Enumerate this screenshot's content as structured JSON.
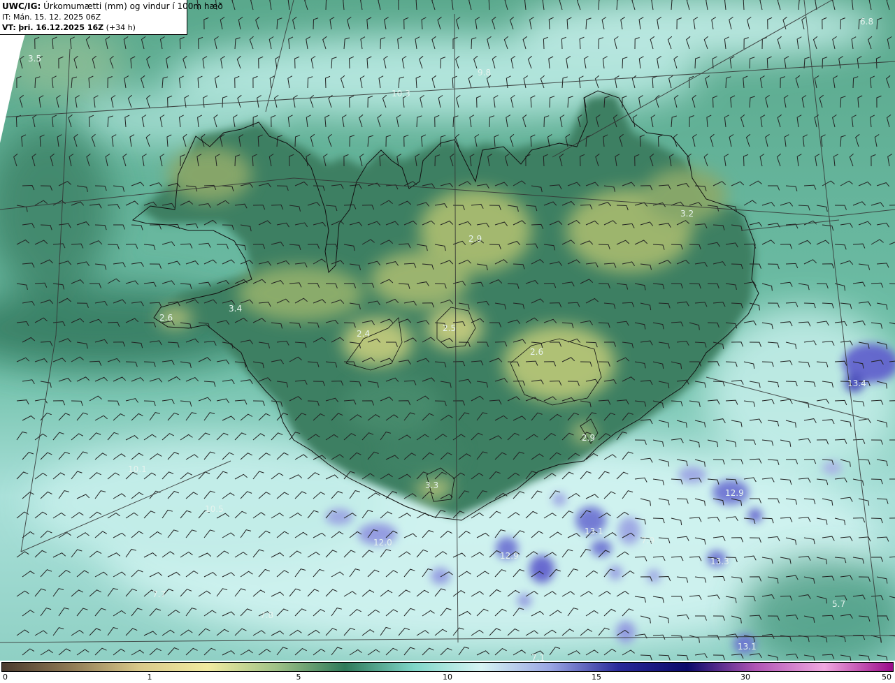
{
  "header": {
    "title_bold": "UWC/IG:",
    "title_rest": "Úrkomumætti (mm) og vindur í 100m hæð",
    "init_time": "IT: Mán. 15. 12. 2025 06Z",
    "valid_bold": "VT:",
    "valid_time": "þri. 16.12.2025 16Z",
    "valid_offset": "(+34 h)"
  },
  "colorbar": {
    "ticks": [
      "0",
      "1",
      "5",
      "10",
      "15",
      "30",
      "50"
    ],
    "colors": [
      "#4a3a2e",
      "#8f7a55",
      "#d9c98a",
      "#f1eba0",
      "#9fc287",
      "#2f7a5a",
      "#7fd6c8",
      "#d6f3f3",
      "#9aa6e4",
      "#2a2a9a",
      "#0a0a6a",
      "#b055b5",
      "#f0a8e0",
      "#9a0a8a"
    ]
  },
  "map_labels": [
    {
      "text": "3.5"
    },
    {
      "text": "9.8"
    },
    {
      "text": "10.3"
    },
    {
      "text": "6.8"
    },
    {
      "text": "3.2"
    },
    {
      "text": "2.9"
    },
    {
      "text": "3.4"
    },
    {
      "text": "2.6"
    },
    {
      "text": "2.4"
    },
    {
      "text": "2.5"
    },
    {
      "text": "2.6"
    },
    {
      "text": "13.4"
    },
    {
      "text": "2.9"
    },
    {
      "text": "3.3"
    },
    {
      "text": "10.1"
    },
    {
      "text": "10.5"
    },
    {
      "text": "12.9"
    },
    {
      "text": "12.0"
    },
    {
      "text": "13.1"
    },
    {
      "text": "7.9"
    },
    {
      "text": "12.9"
    },
    {
      "text": "13.3"
    },
    {
      "text": "5.7"
    },
    {
      "text": "7.7"
    },
    {
      "text": "7.8"
    },
    {
      "text": "13.1"
    },
    {
      "text": "7.1"
    }
  ],
  "colors": {
    "background_land": "#3e8264",
    "ocean_light": "#aee3dc",
    "highland": "#b8c47a",
    "heavy_precip": "#6a70d6",
    "wind_barb": "#222222",
    "coastline": "#111111"
  }
}
